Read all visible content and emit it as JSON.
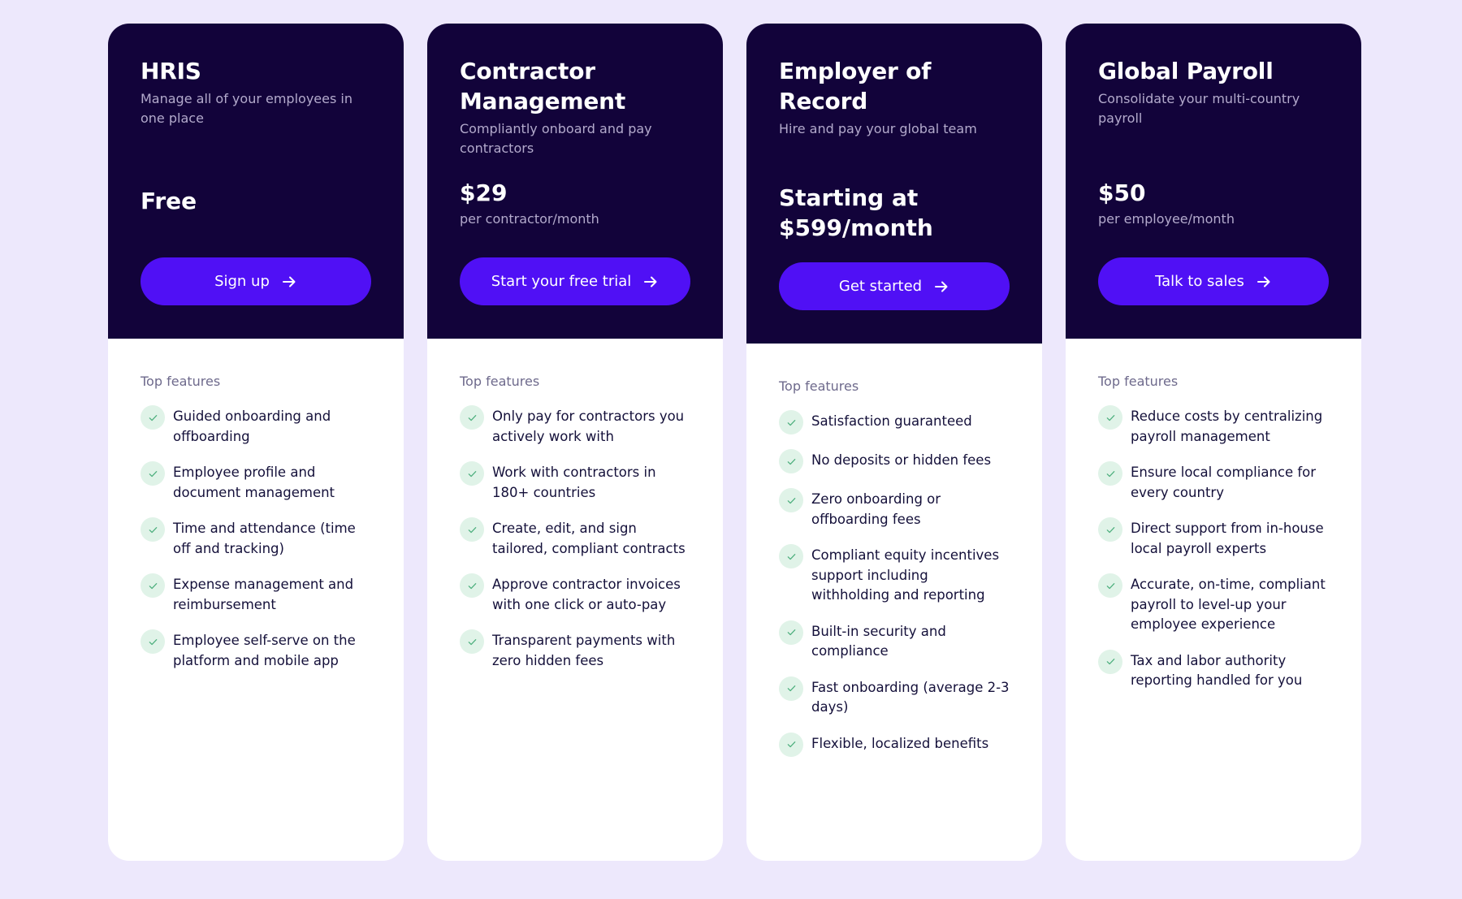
{
  "colors": {
    "page_background": "#EDE8FC",
    "card_header": "#12033A",
    "cta": "#5010F5",
    "check_bg": "#E0F3E8",
    "check": "#4FB07F"
  },
  "plans": [
    {
      "title": "HRIS",
      "subtitle": "Manage all of your employees in one place",
      "price": "Free",
      "price_unit": "",
      "cta_label": "Sign up",
      "cta_icon": "arrow-right-icon",
      "features_label": "Top features",
      "features": [
        "Guided onboarding and offboarding",
        "Employee profile and document management",
        "Time and attendance (time off and tracking)",
        "Expense management and reimbursement",
        "Employee self-serve on the platform and mobile app"
      ]
    },
    {
      "title": "Contractor Management",
      "subtitle": "Compliantly onboard and pay contractors",
      "price": "$29",
      "price_unit": "per contractor/month",
      "cta_label": "Start your free trial",
      "cta_icon": "arrow-right-icon",
      "features_label": "Top features",
      "features": [
        "Only pay for contractors you actively work with",
        "Work with contractors in 180+ countries",
        "Create, edit, and sign tailored, compliant contracts",
        "Approve contractor invoices with one click or auto-pay",
        "Transparent payments with zero hidden fees"
      ]
    },
    {
      "title": "Employer of Record",
      "subtitle": "Hire and pay your global team",
      "price": "Starting at $599/month",
      "price_unit": "",
      "cta_label": "Get started",
      "cta_icon": "arrow-right-icon",
      "features_label": "Top features",
      "features": [
        "Satisfaction guaranteed",
        "No deposits or hidden fees",
        "Zero onboarding or offboarding fees",
        "Compliant equity incentives support including withholding and reporting",
        "Built-in security and compliance",
        "Fast onboarding (average 2-3 days)",
        "Flexible, localized benefits"
      ]
    },
    {
      "title": "Global Payroll",
      "subtitle": "Consolidate your multi-country payroll",
      "price": "$50",
      "price_unit": "per employee/month",
      "cta_label": "Talk to sales",
      "cta_icon": "arrow-right-icon",
      "features_label": "Top features",
      "features": [
        "Reduce costs by centralizing payroll management",
        "Ensure local compliance for every country",
        "Direct support from in-house local payroll experts",
        "Accurate, on-time, compliant payroll to level-up your employee experience",
        "Tax and labor authority reporting handled for you"
      ]
    }
  ]
}
